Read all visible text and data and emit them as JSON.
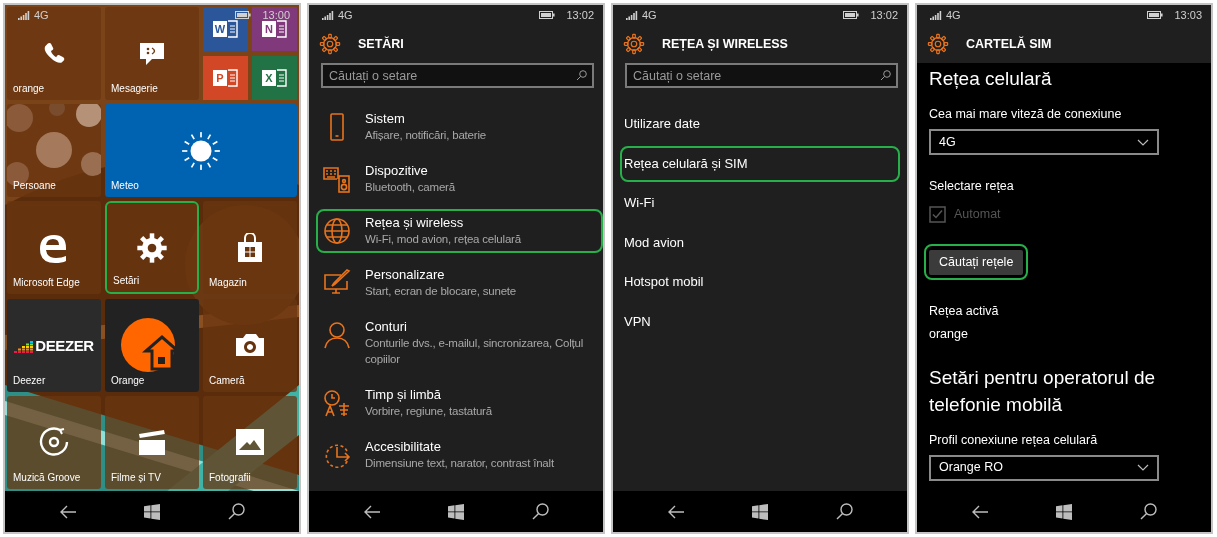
{
  "phones": [
    {
      "kind": "start",
      "status": {
        "network": "4G",
        "time": "13:00"
      },
      "tiles": [
        {
          "kind": "medium",
          "label": "orange",
          "highlighted": false
        },
        {
          "kind": "medium",
          "label": "Mesagerie",
          "highlighted": false
        },
        {
          "kind": "group",
          "tiles": [
            {
              "glyph": "W",
              "color": "#2b579a"
            },
            {
              "glyph": "N",
              "color": "#80397b"
            },
            {
              "glyph": "P",
              "color": "#d24726"
            },
            {
              "glyph": "X",
              "color": "#217346"
            }
          ]
        },
        {
          "kind": "medium",
          "label": "Persoane",
          "highlighted": false
        },
        {
          "kind": "wide",
          "label": "Meteo",
          "color": "#0063b1",
          "highlighted": false
        },
        {
          "kind": "medium",
          "label": "Microsoft Edge",
          "highlighted": false
        },
        {
          "kind": "medium",
          "label": "Setări",
          "highlighted": true
        },
        {
          "kind": "medium",
          "label": "Magazin",
          "highlighted": false
        },
        {
          "kind": "medium",
          "label": "Deezer",
          "logo": "DEEZER",
          "color": "#2b2b2b",
          "highlighted": false
        },
        {
          "kind": "medium",
          "label": "Orange",
          "color": "#222222",
          "highlighted": false
        },
        {
          "kind": "medium",
          "label": "Cameră",
          "highlighted": false
        },
        {
          "kind": "medium",
          "label": "Muzică Groove",
          "highlighted": false
        },
        {
          "kind": "medium",
          "label": "Filme și TV",
          "highlighted": false
        },
        {
          "kind": "medium",
          "label": "Fotografii",
          "highlighted": false
        }
      ]
    },
    {
      "kind": "list",
      "status": {
        "network": "4G",
        "time": "13:02"
      },
      "header": {
        "title": "SETĂRI"
      },
      "search": {
        "placeholder": "Căutați o setare"
      },
      "items": [
        {
          "title": "Sistem",
          "subtitle": "Afișare, notificări, baterie",
          "highlighted": false
        },
        {
          "title": "Dispozitive",
          "subtitle": "Bluetooth, cameră",
          "highlighted": false
        },
        {
          "title": "Rețea și wireless",
          "subtitle": "Wi-Fi, mod avion, rețea celulară",
          "highlighted": true
        },
        {
          "title": "Personalizare",
          "subtitle": "Start, ecran de blocare, sunete",
          "highlighted": false
        },
        {
          "title": "Conturi",
          "subtitle": "Conturile dvs., e-mailul, sincronizarea, Colțul copiilor",
          "highlighted": false
        },
        {
          "title": "Timp și limbă",
          "subtitle": "Vorbire, regiune, tastatură",
          "highlighted": false
        },
        {
          "title": "Accesibilitate",
          "subtitle": "Dimensiune text, narator, contrast înalt",
          "highlighted": false
        }
      ]
    },
    {
      "kind": "list",
      "status": {
        "network": "4G",
        "time": "13:02"
      },
      "header": {
        "title": "REȚEA ȘI WIRELESS"
      },
      "search": {
        "placeholder": "Căutați o setare"
      },
      "items": [
        {
          "title": "Utilizare date",
          "highlighted": false
        },
        {
          "title": "Rețea celulară și SIM",
          "highlighted": true
        },
        {
          "title": "Wi-Fi",
          "highlighted": false
        },
        {
          "title": "Mod avion",
          "highlighted": false
        },
        {
          "title": "Hotspot mobil",
          "highlighted": false
        },
        {
          "title": "VPN",
          "highlighted": false
        }
      ]
    },
    {
      "kind": "form",
      "status": {
        "network": "4G",
        "time": "13:03"
      },
      "header": {
        "title": "CARTELĂ SIM"
      },
      "content": [
        {
          "kind": "heading",
          "text": "Rețea celulară"
        },
        {
          "kind": "label",
          "text": "Cea mai mare viteză de conexiune"
        },
        {
          "kind": "dropdown",
          "value": "4G"
        },
        {
          "kind": "label",
          "text": "Selectare rețea"
        },
        {
          "kind": "checkbox",
          "label": "Automat",
          "checked": true,
          "disabled": true
        },
        {
          "kind": "button",
          "label": "Căutați rețele",
          "highlighted": true
        },
        {
          "kind": "label",
          "text": "Rețea activă"
        },
        {
          "kind": "value",
          "text": "orange"
        },
        {
          "kind": "heading",
          "text": "Setări pentru operatorul de telefonie mobilă"
        },
        {
          "kind": "label",
          "text": "Profil conexiune rețea celulară"
        },
        {
          "kind": "dropdown",
          "value": "Orange RO"
        }
      ]
    }
  ]
}
